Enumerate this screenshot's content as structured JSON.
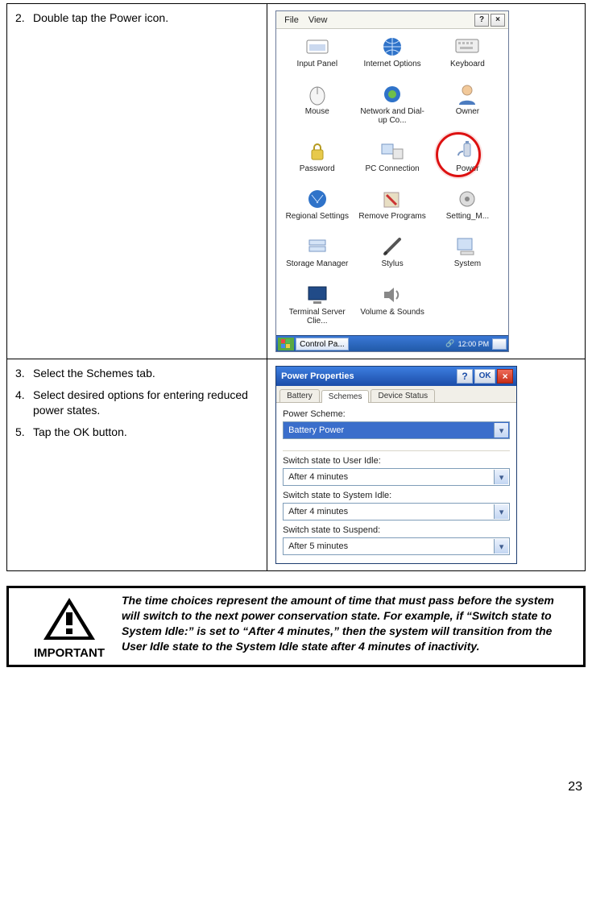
{
  "steps": {
    "s2_num": "2.",
    "s2_text": "Double tap the Power icon.",
    "s3_num": "3.",
    "s3_text": "Select the Schemes tab.",
    "s4_num": "4.",
    "s4_text": "Select desired options for entering reduced power states.",
    "s5_num": "5.",
    "s5_text": "Tap the OK button."
  },
  "controlPanel": {
    "menus": {
      "file": "File",
      "view": "View"
    },
    "helpGlyph": "?",
    "closeGlyph": "×",
    "items": [
      {
        "label": "Input Panel"
      },
      {
        "label": "Internet Options"
      },
      {
        "label": "Keyboard"
      },
      {
        "label": "Mouse"
      },
      {
        "label": "Network and Dial-up Co..."
      },
      {
        "label": "Owner"
      },
      {
        "label": "Password"
      },
      {
        "label": "PC Connection"
      },
      {
        "label": "Power"
      },
      {
        "label": "Regional Settings"
      },
      {
        "label": "Remove Programs"
      },
      {
        "label": "Setting_M..."
      },
      {
        "label": "Storage Manager"
      },
      {
        "label": "Stylus"
      },
      {
        "label": "System"
      },
      {
        "label": "Terminal Server Clie..."
      },
      {
        "label": "Volume & Sounds"
      }
    ],
    "taskbar": {
      "task": "Control Pa...",
      "tray": "12:00 PM"
    }
  },
  "powerProps": {
    "title": "Power Properties",
    "help": "?",
    "ok": "OK",
    "close": "×",
    "tabs": {
      "battery": "Battery",
      "schemes": "Schemes",
      "device": "Device Status"
    },
    "schemeLabel": "Power Scheme:",
    "schemeValue": "Battery Power",
    "userIdleLabel": "Switch state to User Idle:",
    "userIdleValue": "After 4 minutes",
    "sysIdleLabel": "Switch state to System Idle:",
    "sysIdleValue": "After 4 minutes",
    "suspendLabel": "Switch state to Suspend:",
    "suspendValue": "After 5 minutes"
  },
  "important": {
    "caption": "IMPORTANT",
    "text": "The time choices represent the amount of time that must pass before the system will switch to the next power conservation state. For example, if “Switch state to System Idle:” is set to “After 4 minutes,” then the system will transition from the User Idle state to the System Idle state after 4 minutes of inactivity."
  },
  "pageNumber": "23"
}
